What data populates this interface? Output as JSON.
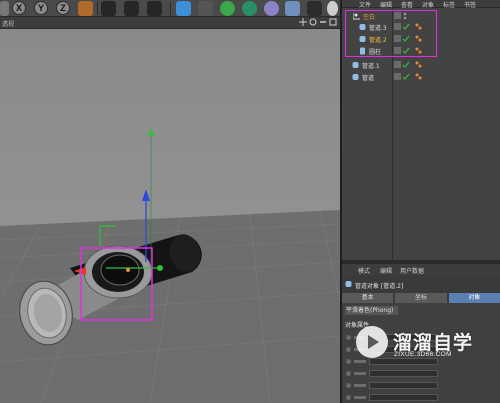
{
  "toolbar": {
    "axis_buttons": [
      "X",
      "Y",
      "Z"
    ]
  },
  "viewport": {
    "header_label": "透视"
  },
  "object_manager": {
    "menu": [
      "文件",
      "编辑",
      "查看",
      "对象",
      "标签",
      "书签"
    ],
    "objects": [
      {
        "name": "空白",
        "level": 0,
        "icon": "null-icon",
        "color": "#e8a23a"
      },
      {
        "name": "管道.3",
        "level": 1,
        "icon": "tube-icon",
        "color": "#dcdcdc"
      },
      {
        "name": "管道.2",
        "level": 1,
        "icon": "tube-icon",
        "color": "#ffb84a"
      },
      {
        "name": "圆柱",
        "level": 1,
        "icon": "cylinder-icon",
        "color": "#dcdcdc"
      },
      {
        "name": "管道.1",
        "level": 0,
        "icon": "tube-icon",
        "color": "#dcdcdc"
      },
      {
        "name": "管道",
        "level": 0,
        "icon": "tube-icon",
        "color": "#dcdcdc"
      }
    ]
  },
  "attribute_manager": {
    "menu": [
      "模式",
      "编辑",
      "用户数据"
    ],
    "title": "管道对象 [管道.2]",
    "tabs": [
      "基本",
      "坐标",
      "对象"
    ],
    "active_tab": "对象",
    "phong": "平滑着色(Phong)",
    "section": "对象属性"
  },
  "watermark": {
    "brand": "溜溜自学",
    "url": "ZIXUE.3D66.COM"
  },
  "colors": {
    "highlight": "#e22ee2",
    "accent_tab": "#5a7fb2",
    "gizmo_y": "#2fbf3a",
    "gizmo_z": "#2a4bd8",
    "gizmo_x": "#e23b2a"
  }
}
